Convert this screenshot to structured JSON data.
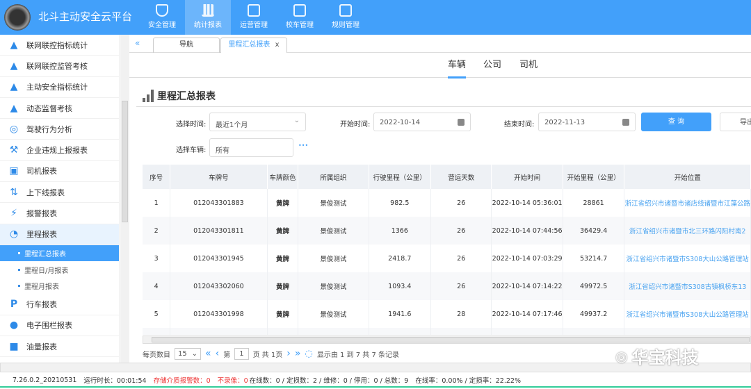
{
  "header": {
    "title": "北斗主动安全云平台",
    "nav": [
      {
        "label": "安全管理",
        "icon": "shield-play-icon"
      },
      {
        "label": "统计报表",
        "icon": "bar-chart-icon",
        "active": true
      },
      {
        "label": "运营管理",
        "icon": "device-icon"
      },
      {
        "label": "校车管理",
        "icon": "device-icon"
      },
      {
        "label": "规则管理",
        "icon": "window-icon"
      }
    ]
  },
  "sidebar": {
    "items": [
      {
        "label": "联网联控指标统计",
        "icon": "warning-icon"
      },
      {
        "label": "联网联控监管考核",
        "icon": "warning-icon"
      },
      {
        "label": "主动安全指标统计",
        "icon": "warning-icon"
      },
      {
        "label": "动态监督考核",
        "icon": "warning-icon"
      },
      {
        "label": "驾驶行为分析",
        "icon": "steering-wheel-icon"
      },
      {
        "label": "企业违规上报报表",
        "icon": "gavel-icon"
      },
      {
        "label": "司机报表",
        "icon": "person-icon"
      },
      {
        "label": "上下线报表",
        "icon": "up-down-icon"
      },
      {
        "label": "报警报表",
        "icon": "alarm-icon"
      },
      {
        "label": "里程报表",
        "icon": "gauge-icon",
        "expanded": true
      }
    ],
    "sub": [
      {
        "label": "里程汇总报表",
        "active": true
      },
      {
        "label": "里程日/月报表"
      },
      {
        "label": "里程月报表"
      }
    ],
    "items2": [
      {
        "label": "行车报表",
        "icon": "parking-icon"
      },
      {
        "label": "电子围栏报表",
        "icon": "location-pin-icon"
      },
      {
        "label": "油量报表",
        "icon": "fuel-icon"
      }
    ]
  },
  "tabs": [
    {
      "label": "导航"
    },
    {
      "label": "里程汇总报表",
      "active": true,
      "close": "x"
    }
  ],
  "subtabs": [
    {
      "label": "车辆",
      "active": true
    },
    {
      "label": "公司"
    },
    {
      "label": "司机"
    }
  ],
  "page": {
    "title": "里程汇总报表"
  },
  "filters": {
    "time_label": "选择时间:",
    "time_value": "最近1个月",
    "start_label": "开始时间:",
    "start_value": "2022-10-14",
    "end_label": "结束时间:",
    "end_value": "2022-11-13",
    "query": "查 询",
    "export": "导出",
    "vehicle_label": "选择车辆:",
    "vehicle_value": "所有",
    "more": "•••"
  },
  "table": {
    "columns": [
      "序号",
      "车牌号",
      "车牌颜色",
      "所属组织",
      "行驶里程（公里）",
      "营运天数",
      "开始时间",
      "开始里程（公里）",
      "开始位置"
    ],
    "rows": [
      [
        "1",
        "012043301883",
        "黄牌",
        "景俊测试",
        "982.5",
        "26",
        "2022-10-14 05:36:01",
        "28861",
        "浙江省绍兴市诸暨市诸店线诸暨市江藻公路"
      ],
      [
        "2",
        "012043301811",
        "黄牌",
        "景俊测试",
        "1366",
        "26",
        "2022-10-14 07:44:56",
        "36429.4",
        "浙江省绍兴市诸暨市北三环路闪阳村南2"
      ],
      [
        "3",
        "012043301945",
        "黄牌",
        "景俊测试",
        "2418.7",
        "26",
        "2022-10-14 07:03:29",
        "53214.7",
        "浙江省绍兴市诸暨市S308大山公路管理站"
      ],
      [
        "4",
        "012043302060",
        "黄牌",
        "景俊测试",
        "1093.4",
        "26",
        "2022-10-14 07:14:22",
        "49972.5",
        "浙江省绍兴市诸暨市S308古镇枫桥东13"
      ],
      [
        "5",
        "012043301998",
        "黄牌",
        "景俊测试",
        "1941.6",
        "28",
        "2022-10-14 07:17:46",
        "49937.2",
        "浙江省绍兴市诸暨市S308大山公路管理站"
      ]
    ]
  },
  "pagination": {
    "per_page_label": "每页数目",
    "per_page": "15",
    "page_prefix": "第",
    "page": "1",
    "page_suffix": "页 共 1页",
    "summary": "显示由 1 到 7 共 7 条记录"
  },
  "status": {
    "version": "7.26.0.2_20210531",
    "runtime": "运行时长：00:01:54",
    "storage_alarm": "存储介质报警数：0",
    "no_record": "不录像：0",
    "counts": "在线数：0 / 定损数：2 / 维修：0 / 停用：0 / 总数：9",
    "rates": "在线率：0.00% / 定损率：22.22%"
  },
  "watermark": "华宝科技",
  "colors": {
    "primary": "#42a0fa",
    "link": "#4aa3f0",
    "alert": "#e33333"
  }
}
